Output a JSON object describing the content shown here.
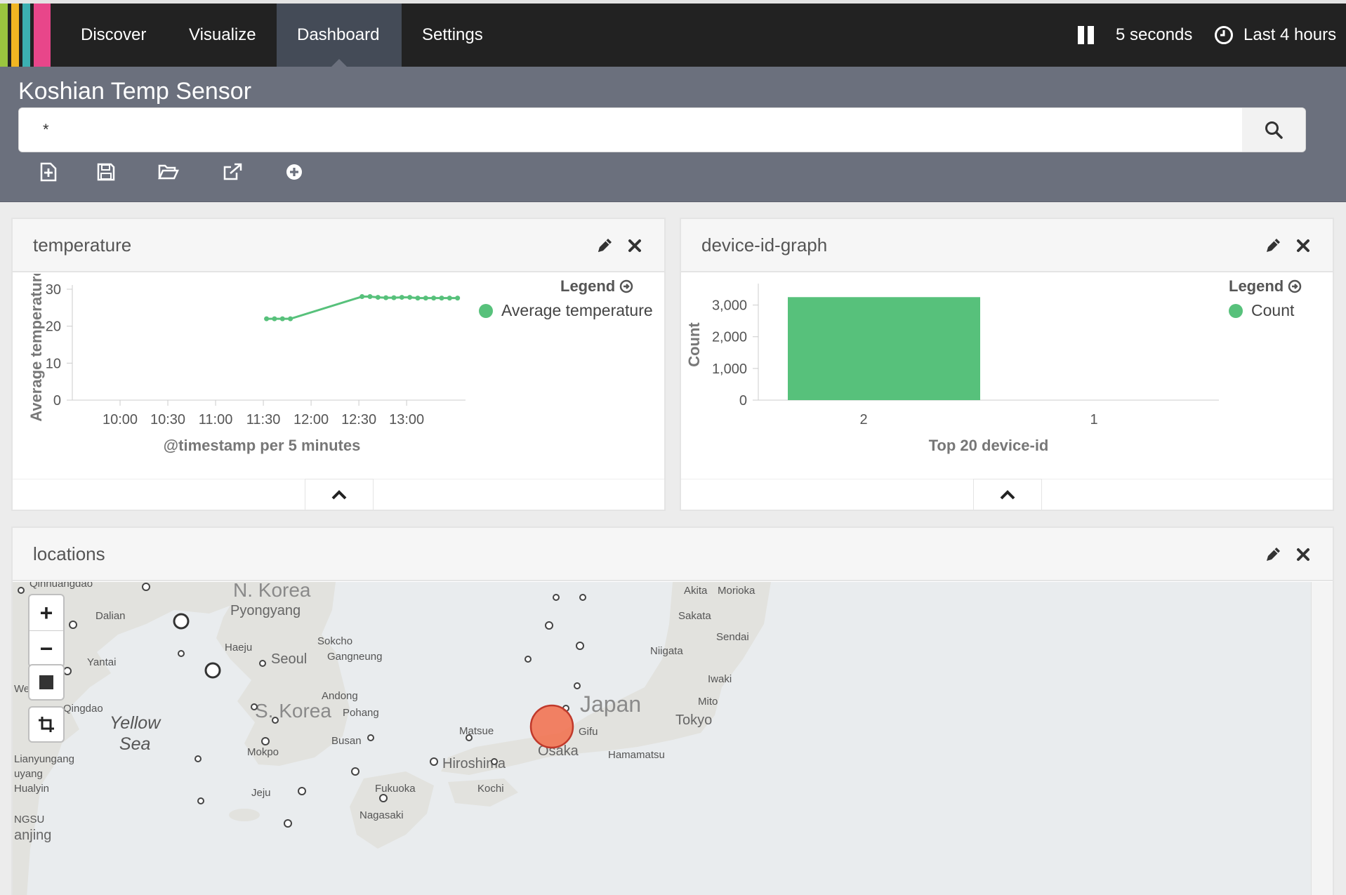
{
  "nav": {
    "logo_colors": [
      "#9ac53f",
      "#f0b522",
      "#3cb0b2",
      "#e8468a"
    ],
    "tabs": [
      {
        "label": "Discover",
        "active": false
      },
      {
        "label": "Visualize",
        "active": false
      },
      {
        "label": "Dashboard",
        "active": true
      },
      {
        "label": "Settings",
        "active": false
      }
    ],
    "refresh_interval": "5 seconds",
    "time_range": "Last 4 hours",
    "icons": {
      "pause": "pause-icon",
      "clock": "clock-icon"
    }
  },
  "dashboard": {
    "title": "Koshian Temp Sensor",
    "query": "*",
    "toolbar_icons": [
      "new-dashboard-icon",
      "save-icon",
      "open-folder-icon",
      "share-icon",
      "add-panel-icon"
    ]
  },
  "panels": {
    "temperature": {
      "title": "temperature",
      "legend_title": "Legend",
      "series_color": "#57c17b"
    },
    "device": {
      "title": "device-id-graph",
      "legend_title": "Legend",
      "series_color": "#57c17b"
    },
    "locations": {
      "title": "locations",
      "marker_color": "#f26d4a"
    }
  },
  "chart_data": [
    {
      "type": "line",
      "xlabel": "@timestamp per 5 minutes",
      "ylabel": "Average temperature",
      "ylim": [
        0,
        30
      ],
      "yticks": [
        "0",
        "10",
        "20",
        "30"
      ],
      "xticks": [
        "10:00",
        "10:30",
        "11:00",
        "11:30",
        "12:00",
        "12:30",
        "13:00"
      ],
      "legend": "top-right",
      "series": [
        {
          "name": "Average temperature",
          "x": [
            "11:32",
            "11:37",
            "11:42",
            "11:47",
            "12:32",
            "12:37",
            "12:42",
            "12:47",
            "12:52",
            "12:57",
            "13:02",
            "13:07",
            "13:12",
            "13:17",
            "13:22",
            "13:27",
            "13:32"
          ],
          "values": [
            22,
            22,
            22,
            22,
            28,
            28,
            27.8,
            27.7,
            27.7,
            27.8,
            27.8,
            27.6,
            27.6,
            27.6,
            27.6,
            27.6,
            27.6
          ]
        }
      ]
    },
    {
      "type": "bar",
      "xlabel": "Top 20 device-id",
      "ylabel": "Count",
      "ylim": [
        0,
        3500
      ],
      "yticks": [
        "0",
        "1,000",
        "2,000",
        "3,000"
      ],
      "categories": [
        "2",
        "1"
      ],
      "legend": "top-right",
      "series": [
        {
          "name": "Count",
          "values": [
            3250,
            0
          ]
        }
      ]
    }
  ],
  "map": {
    "countries": [
      "N. Korea",
      "S. Korea",
      "Japan"
    ],
    "seas": [
      "Yellow Sea"
    ],
    "cities": [
      "Qinhuangdao",
      "Dalian",
      "Pyongyang",
      "Haeju",
      "Seoul",
      "Sokcho",
      "Gangneung",
      "Yantai",
      "Andong",
      "Pohang",
      "Qingdao",
      "Busan",
      "Mokpo",
      "Lianyungang",
      "uyang",
      "Hualyin",
      "Jeju",
      "NGSU",
      "anjing",
      "Akita",
      "Morioka",
      "Sakata",
      "Sendai",
      "Niigata",
      "Iwaki",
      "Mito",
      "Tokyo",
      "Gifu",
      "Matsue",
      "Osaka",
      "Hamamatsu",
      "Hiroshima",
      "Fukuoka",
      "Kochi",
      "Nagasaki",
      "We"
    ],
    "controls": {
      "zoom_in": "+",
      "zoom_out": "−"
    }
  }
}
